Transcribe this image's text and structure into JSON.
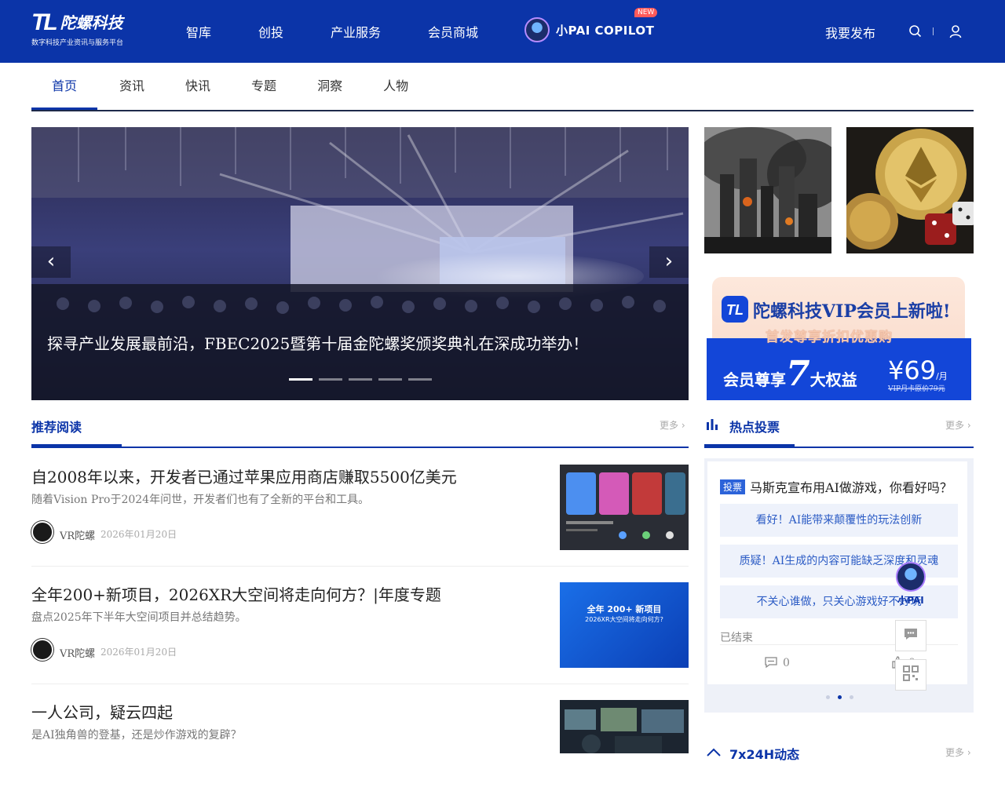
{
  "brand": {
    "name_mark": "TL",
    "name_cn": "陀螺科技",
    "tagline": "数字科技产业资讯与服务平台"
  },
  "nav": {
    "items": [
      {
        "label": "智库"
      },
      {
        "label": "创投"
      },
      {
        "label": "产业服务"
      },
      {
        "label": "会员商城"
      }
    ],
    "copilot_label": "小PAI COPILOT",
    "copilot_badge": "NEW",
    "publish_label": "我要发布",
    "search_icon": "search-icon",
    "user_icon": "user-icon"
  },
  "subnav": {
    "tabs": [
      {
        "label": "首页",
        "active": true
      },
      {
        "label": "资讯"
      },
      {
        "label": "快讯"
      },
      {
        "label": "专题"
      },
      {
        "label": "洞察"
      },
      {
        "label": "人物"
      }
    ]
  },
  "hero": {
    "caption": "探寻产业发展最前沿，FBEC2025暨第十届金陀螺奖颁奖典礼在深成功举办！",
    "prev_label": "‹",
    "next_label": "›",
    "slide_count": 5,
    "active_slide": 1
  },
  "vip_banner": {
    "title": "陀螺科技VIP会员上新啦!",
    "subtitle": "首发尊享折扣优惠购",
    "benefit_prefix": "会员尊享",
    "benefit_number": "7",
    "benefit_suffix": "大权益",
    "price": "¥69",
    "price_unit": "/月",
    "original_price": "VIP月卡原价79元"
  },
  "recommend": {
    "title": "推荐阅读",
    "more": "更多 ›",
    "articles": [
      {
        "title": "自2008年以来，开发者已通过苹果应用商店赚取5500亿美元",
        "desc": "随着Vision Pro于2024年问世，开发者们也有了全新的平台和工具。",
        "author": "VR陀螺",
        "date": "2026年01月20日"
      },
      {
        "title": "全年200+新项目，2026XR大空间将走向何方？|年度专题",
        "desc": "盘点2025年下半年大空间项目并总结趋势。",
        "author": "VR陀螺",
        "date": "2026年01月20日",
        "img_text_1": "全年 200+ 新项目",
        "img_text_2": "2026XR大空间将走向何方?"
      },
      {
        "title": "一人公司，疑云四起",
        "desc": "是AI独角兽的登基，还是炒作游戏的复辟？"
      }
    ]
  },
  "poll_section": {
    "title": "热点投票",
    "more": "更多 ›",
    "badge": "投票",
    "question": "马斯克宣布用AI做游戏，你看好吗？",
    "options": [
      {
        "label": "看好！AI能带来颠覆性的玩法创新"
      },
      {
        "label": "质疑！AI生成的内容可能缺乏深度和灵魂"
      },
      {
        "label": "不关心谁做，只关心游戏好不好玩"
      }
    ],
    "status": "已结束",
    "comments": "0",
    "likes": "0"
  },
  "float": {
    "pai_label": "小PAI"
  },
  "live": {
    "title": "7x24H动态",
    "more": "更多 ›"
  },
  "colors": {
    "brand_blue": "#0b34a8",
    "poll_option_bg": "#eef2fb",
    "poll_option_text": "#2c5cc5"
  }
}
